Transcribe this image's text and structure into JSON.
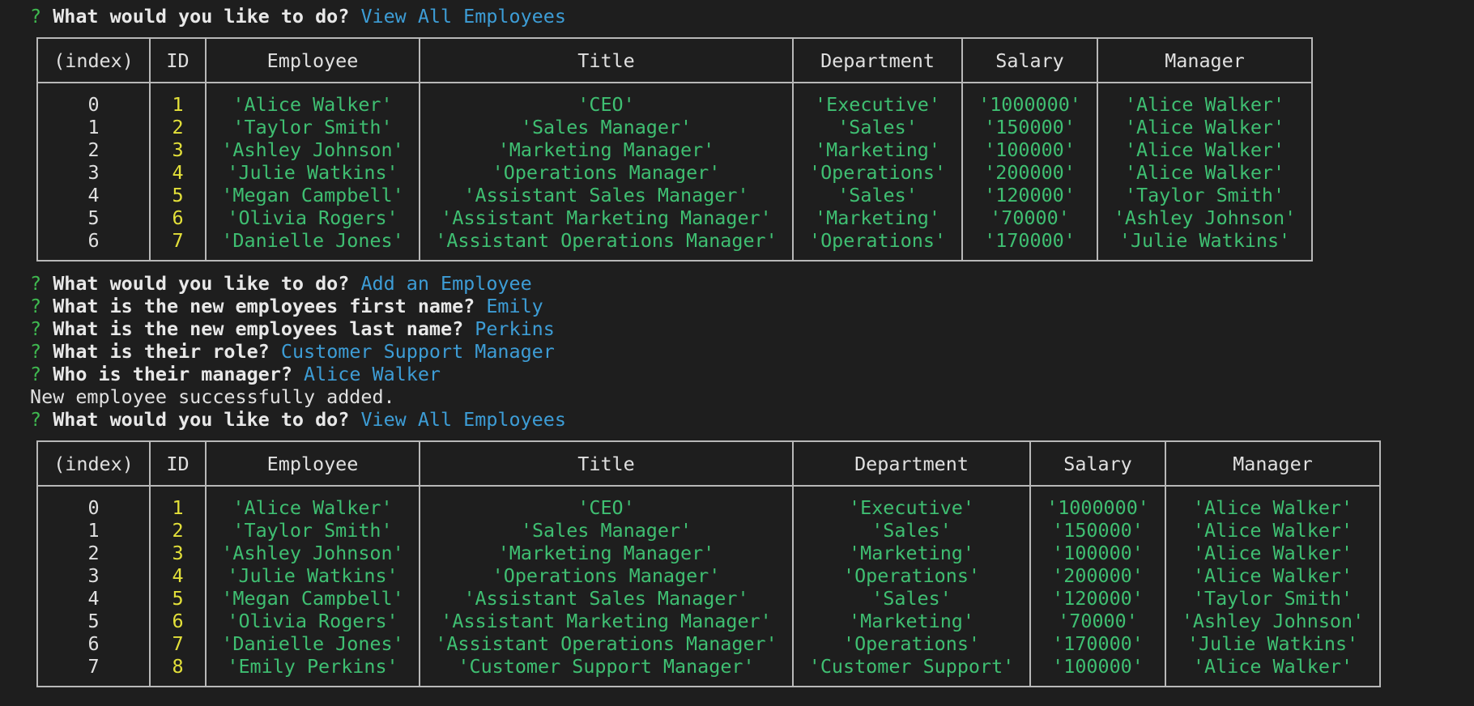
{
  "prompt1": {
    "mark": "?",
    "question": "What would you like to do?",
    "answer": "View All Employees"
  },
  "table1": {
    "headers": [
      "(index)",
      "ID",
      "Employee",
      "Title",
      "Department",
      "Salary",
      "Manager"
    ],
    "rows": [
      {
        "index": "0",
        "id": "1",
        "employee": "'Alice Walker'",
        "title": "'CEO'",
        "department": "'Executive'",
        "salary": "'1000000'",
        "manager": "'Alice Walker'"
      },
      {
        "index": "1",
        "id": "2",
        "employee": "'Taylor Smith'",
        "title": "'Sales Manager'",
        "department": "'Sales'",
        "salary": "'150000'",
        "manager": "'Alice Walker'"
      },
      {
        "index": "2",
        "id": "3",
        "employee": "'Ashley Johnson'",
        "title": "'Marketing Manager'",
        "department": "'Marketing'",
        "salary": "'100000'",
        "manager": "'Alice Walker'"
      },
      {
        "index": "3",
        "id": "4",
        "employee": "'Julie Watkins'",
        "title": "'Operations Manager'",
        "department": "'Operations'",
        "salary": "'200000'",
        "manager": "'Alice Walker'"
      },
      {
        "index": "4",
        "id": "5",
        "employee": "'Megan Campbell'",
        "title": "'Assistant Sales Manager'",
        "department": "'Sales'",
        "salary": "'120000'",
        "manager": "'Taylor Smith'"
      },
      {
        "index": "5",
        "id": "6",
        "employee": "'Olivia Rogers'",
        "title": "'Assistant Marketing Manager'",
        "department": "'Marketing'",
        "salary": "'70000'",
        "manager": "'Ashley Johnson'"
      },
      {
        "index": "6",
        "id": "7",
        "employee": "'Danielle Jones'",
        "title": "'Assistant Operations Manager'",
        "department": "'Operations'",
        "salary": "'170000'",
        "manager": "'Julie Watkins'"
      }
    ]
  },
  "add_flow": [
    {
      "mark": "?",
      "question": "What would you like to do?",
      "answer": "Add an Employee"
    },
    {
      "mark": "?",
      "question": "What is the new employees first name?",
      "answer": "Emily"
    },
    {
      "mark": "?",
      "question": "What is the new employees last name?",
      "answer": "Perkins"
    },
    {
      "mark": "?",
      "question": "What is their role?",
      "answer": "Customer Support Manager"
    },
    {
      "mark": "?",
      "question": "Who is their manager?",
      "answer": "Alice Walker"
    }
  ],
  "success_message": "New employee successfully added.",
  "prompt2": {
    "mark": "?",
    "question": "What would you like to do?",
    "answer": "View All Employees"
  },
  "table2": {
    "headers": [
      "(index)",
      "ID",
      "Employee",
      "Title",
      "Department",
      "Salary",
      "Manager"
    ],
    "rows": [
      {
        "index": "0",
        "id": "1",
        "employee": "'Alice Walker'",
        "title": "'CEO'",
        "department": "'Executive'",
        "salary": "'1000000'",
        "manager": "'Alice Walker'"
      },
      {
        "index": "1",
        "id": "2",
        "employee": "'Taylor Smith'",
        "title": "'Sales Manager'",
        "department": "'Sales'",
        "salary": "'150000'",
        "manager": "'Alice Walker'"
      },
      {
        "index": "2",
        "id": "3",
        "employee": "'Ashley Johnson'",
        "title": "'Marketing Manager'",
        "department": "'Marketing'",
        "salary": "'100000'",
        "manager": "'Alice Walker'"
      },
      {
        "index": "3",
        "id": "4",
        "employee": "'Julie Watkins'",
        "title": "'Operations Manager'",
        "department": "'Operations'",
        "salary": "'200000'",
        "manager": "'Alice Walker'"
      },
      {
        "index": "4",
        "id": "5",
        "employee": "'Megan Campbell'",
        "title": "'Assistant Sales Manager'",
        "department": "'Sales'",
        "salary": "'120000'",
        "manager": "'Taylor Smith'"
      },
      {
        "index": "5",
        "id": "6",
        "employee": "'Olivia Rogers'",
        "title": "'Assistant Marketing Manager'",
        "department": "'Marketing'",
        "salary": "'70000'",
        "manager": "'Ashley Johnson'"
      },
      {
        "index": "6",
        "id": "7",
        "employee": "'Danielle Jones'",
        "title": "'Assistant Operations Manager'",
        "department": "'Operations'",
        "salary": "'170000'",
        "manager": "'Julie Watkins'"
      },
      {
        "index": "7",
        "id": "8",
        "employee": "'Emily Perkins'",
        "title": "'Customer Support Manager'",
        "department": "'Customer Support'",
        "salary": "'100000'",
        "manager": "'Alice Walker'"
      }
    ]
  },
  "colors": {
    "background": "#1e1e1e",
    "prompt_mark": "#3fb950",
    "answer": "#3d9dd6",
    "string_value": "#3fbf72",
    "id_number": "#e3e03a",
    "border": "#b8b8b8"
  }
}
